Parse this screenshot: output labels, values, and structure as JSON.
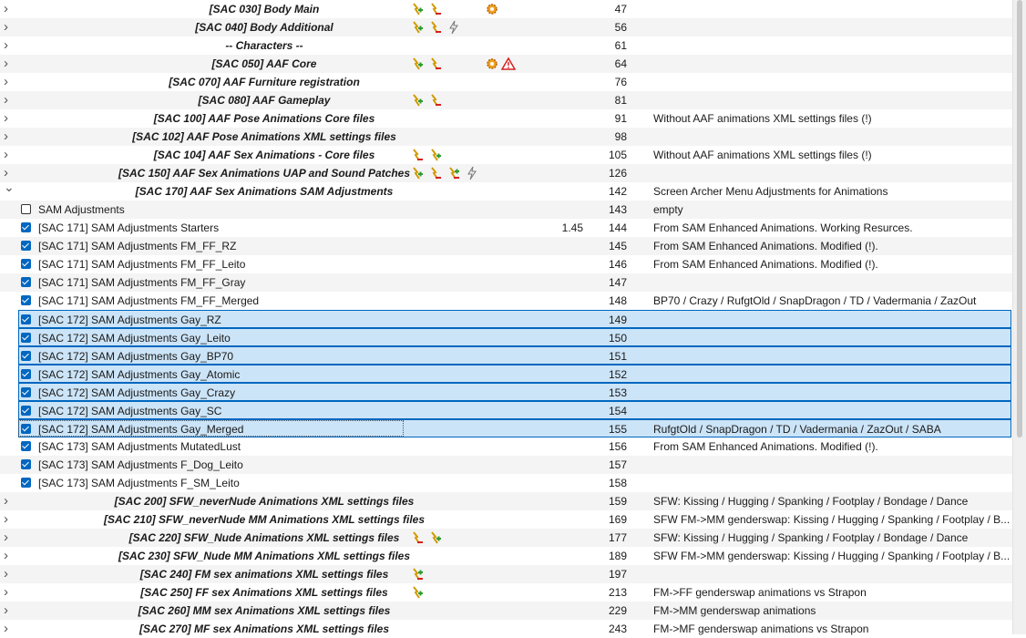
{
  "rows": [
    {
      "kind": "sep",
      "name": "[SAC 030] Body Main",
      "prio": "47",
      "note": "",
      "flags": [
        "plug-green",
        "plug-red",
        "gear-orange"
      ]
    },
    {
      "kind": "sep",
      "name": "[SAC 040] Body Additional",
      "prio": "56",
      "note": "",
      "flags": [
        "plug-green",
        "plug-red",
        "lightning-gray"
      ]
    },
    {
      "kind": "sep",
      "name": "-- Characters --",
      "prio": "61",
      "note": "",
      "flags": []
    },
    {
      "kind": "sep",
      "name": "[SAC 050] AAF Core",
      "prio": "64",
      "note": "",
      "flags": [
        "plug-green",
        "plug-red",
        "gear-orange",
        "warning-red"
      ]
    },
    {
      "kind": "sep",
      "name": "[SAC 070] AAF Furniture registration",
      "prio": "76",
      "note": "",
      "flags": []
    },
    {
      "kind": "sep",
      "name": "[SAC 080] AAF Gameplay",
      "prio": "81",
      "note": "",
      "flags": [
        "plug-green",
        "plug-red"
      ]
    },
    {
      "kind": "sep",
      "name": "[SAC 100] AAF Pose Animations Core files",
      "prio": "91",
      "note": "Without AAF animations XML settings files (!)",
      "flags": []
    },
    {
      "kind": "sep",
      "name": "[SAC 102] AAF Pose Animations XML settings files",
      "prio": "98",
      "note": "",
      "flags": []
    },
    {
      "kind": "sep",
      "name": "[SAC 104] AAF Sex Animations - Core files",
      "prio": "105",
      "note": "Without AAF animations XML settings files (!)",
      "flags": [
        "plug-red",
        "plug-green"
      ]
    },
    {
      "kind": "sep",
      "name": "[SAC 150] AAF Sex Animations UAP and Sound Patches",
      "prio": "126",
      "note": "",
      "flags": [
        "plug-green",
        "plug-red",
        "plug-both",
        "lightning-gray"
      ]
    },
    {
      "kind": "sep-open",
      "name": "[SAC 170] AAF Sex Animations SAM Adjustments",
      "prio": "142",
      "note": "Screen Archer Menu Adjustments for Animations",
      "flags": []
    },
    {
      "kind": "mod",
      "checked": false,
      "name": "SAM Adjustments",
      "version": "",
      "prio": "143",
      "note": "empty"
    },
    {
      "kind": "mod",
      "checked": true,
      "name": "[SAC 171] SAM Adjustments Starters",
      "version": "1.45",
      "prio": "144",
      "note": "From SAM Enhanced Animations. Working Resurces."
    },
    {
      "kind": "mod",
      "checked": true,
      "name": "[SAC 171] SAM Adjustments FM_FF_RZ",
      "version": "",
      "prio": "145",
      "note": "From SAM Enhanced Animations. Modified (!)."
    },
    {
      "kind": "mod",
      "checked": true,
      "name": "[SAC 171] SAM Adjustments FM_FF_Leito",
      "version": "",
      "prio": "146",
      "note": "From SAM Enhanced Animations. Modified (!)."
    },
    {
      "kind": "mod",
      "checked": true,
      "name": "[SAC 171] SAM Adjustments FM_FF_Gray",
      "version": "",
      "prio": "147",
      "note": ""
    },
    {
      "kind": "mod",
      "checked": true,
      "name": "[SAC 171] SAM Adjustments FM_FF_Merged",
      "version": "",
      "prio": "148",
      "note": "BP70 / Crazy / RufgtOld / SnapDragon / TD / Vadermania / ZazOut"
    },
    {
      "kind": "mod",
      "checked": true,
      "selected": true,
      "name": "[SAC 172] SAM Adjustments Gay_RZ",
      "version": "",
      "prio": "149",
      "note": ""
    },
    {
      "kind": "mod",
      "checked": true,
      "selected": true,
      "name": "[SAC 172] SAM Adjustments Gay_Leito",
      "version": "",
      "prio": "150",
      "note": ""
    },
    {
      "kind": "mod",
      "checked": true,
      "selected": true,
      "name": "[SAC 172] SAM Adjustments Gay_BP70",
      "version": "",
      "prio": "151",
      "note": ""
    },
    {
      "kind": "mod",
      "checked": true,
      "selected": true,
      "name": "[SAC 172] SAM Adjustments Gay_Atomic",
      "version": "",
      "prio": "152",
      "note": ""
    },
    {
      "kind": "mod",
      "checked": true,
      "selected": true,
      "name": "[SAC 172] SAM Adjustments Gay_Crazy",
      "version": "",
      "prio": "153",
      "note": ""
    },
    {
      "kind": "mod",
      "checked": true,
      "selected": true,
      "name": "[SAC 172] SAM Adjustments Gay_SC",
      "version": "",
      "prio": "154",
      "note": ""
    },
    {
      "kind": "mod",
      "checked": true,
      "selected": true,
      "focused": true,
      "name": "[SAC 172] SAM Adjustments Gay_Merged",
      "version": "",
      "prio": "155",
      "note": "RufgtOld / SnapDragon / TD / Vadermania / ZazOut / SABA"
    },
    {
      "kind": "mod",
      "checked": true,
      "name": "[SAC 173] SAM Adjustments MutatedLust",
      "version": "",
      "prio": "156",
      "note": "From SAM Enhanced Animations. Modified (!)."
    },
    {
      "kind": "mod",
      "checked": true,
      "name": "[SAC 173] SAM Adjustments F_Dog_Leito",
      "version": "",
      "prio": "157",
      "note": ""
    },
    {
      "kind": "mod",
      "checked": true,
      "name": "[SAC 173] SAM Adjustments F_SM_Leito",
      "version": "",
      "prio": "158",
      "note": ""
    },
    {
      "kind": "sep",
      "name": "[SAC 200] SFW_neverNude Animations XML settings files",
      "prio": "159",
      "note": "SFW: Kissing / Hugging / Spanking / Footplay / Bondage / Dance",
      "flags": []
    },
    {
      "kind": "sep",
      "name": "[SAC 210] SFW_neverNude MM Animations XML settings files",
      "prio": "169",
      "note": "SFW FM->MM genderswap: Kissing / Hugging / Spanking / Footplay / B...",
      "flags": []
    },
    {
      "kind": "sep",
      "name": "[SAC 220] SFW_Nude Animations XML settings files",
      "prio": "177",
      "note": "SFW: Kissing / Hugging / Spanking / Footplay / Bondage / Dance",
      "flags": [
        "plug-red",
        "plug-green"
      ]
    },
    {
      "kind": "sep",
      "name": "[SAC 230] SFW_Nude MM Animations XML settings files",
      "prio": "189",
      "note": "SFW FM->MM genderswap: Kissing / Hugging / Spanking / Footplay / B...",
      "flags": []
    },
    {
      "kind": "sep",
      "name": "[SAC 240] FM sex animations XML settings files",
      "prio": "197",
      "note": "",
      "flags": [
        "plug-both"
      ]
    },
    {
      "kind": "sep",
      "name": "[SAC 250] FF sex Animations XML settings files",
      "prio": "213",
      "note": "FM->FF genderswap animations vs Strapon",
      "flags": [
        "plug-green"
      ]
    },
    {
      "kind": "sep",
      "name": "[SAC 260] MM sex Animations XML settings files",
      "prio": "229",
      "note": "FM->MM genderswap animations",
      "flags": []
    },
    {
      "kind": "sep",
      "name": "[SAC 270] MF sex Animations XML settings files",
      "prio": "243",
      "note": "FM->MF genderswap animations vs Strapon",
      "flags": []
    }
  ],
  "colors": {
    "selection": "#cce4f7",
    "selection_border": "#0067c0",
    "checkbox": "#0067c0",
    "alt_row": "#f4f4f4"
  }
}
